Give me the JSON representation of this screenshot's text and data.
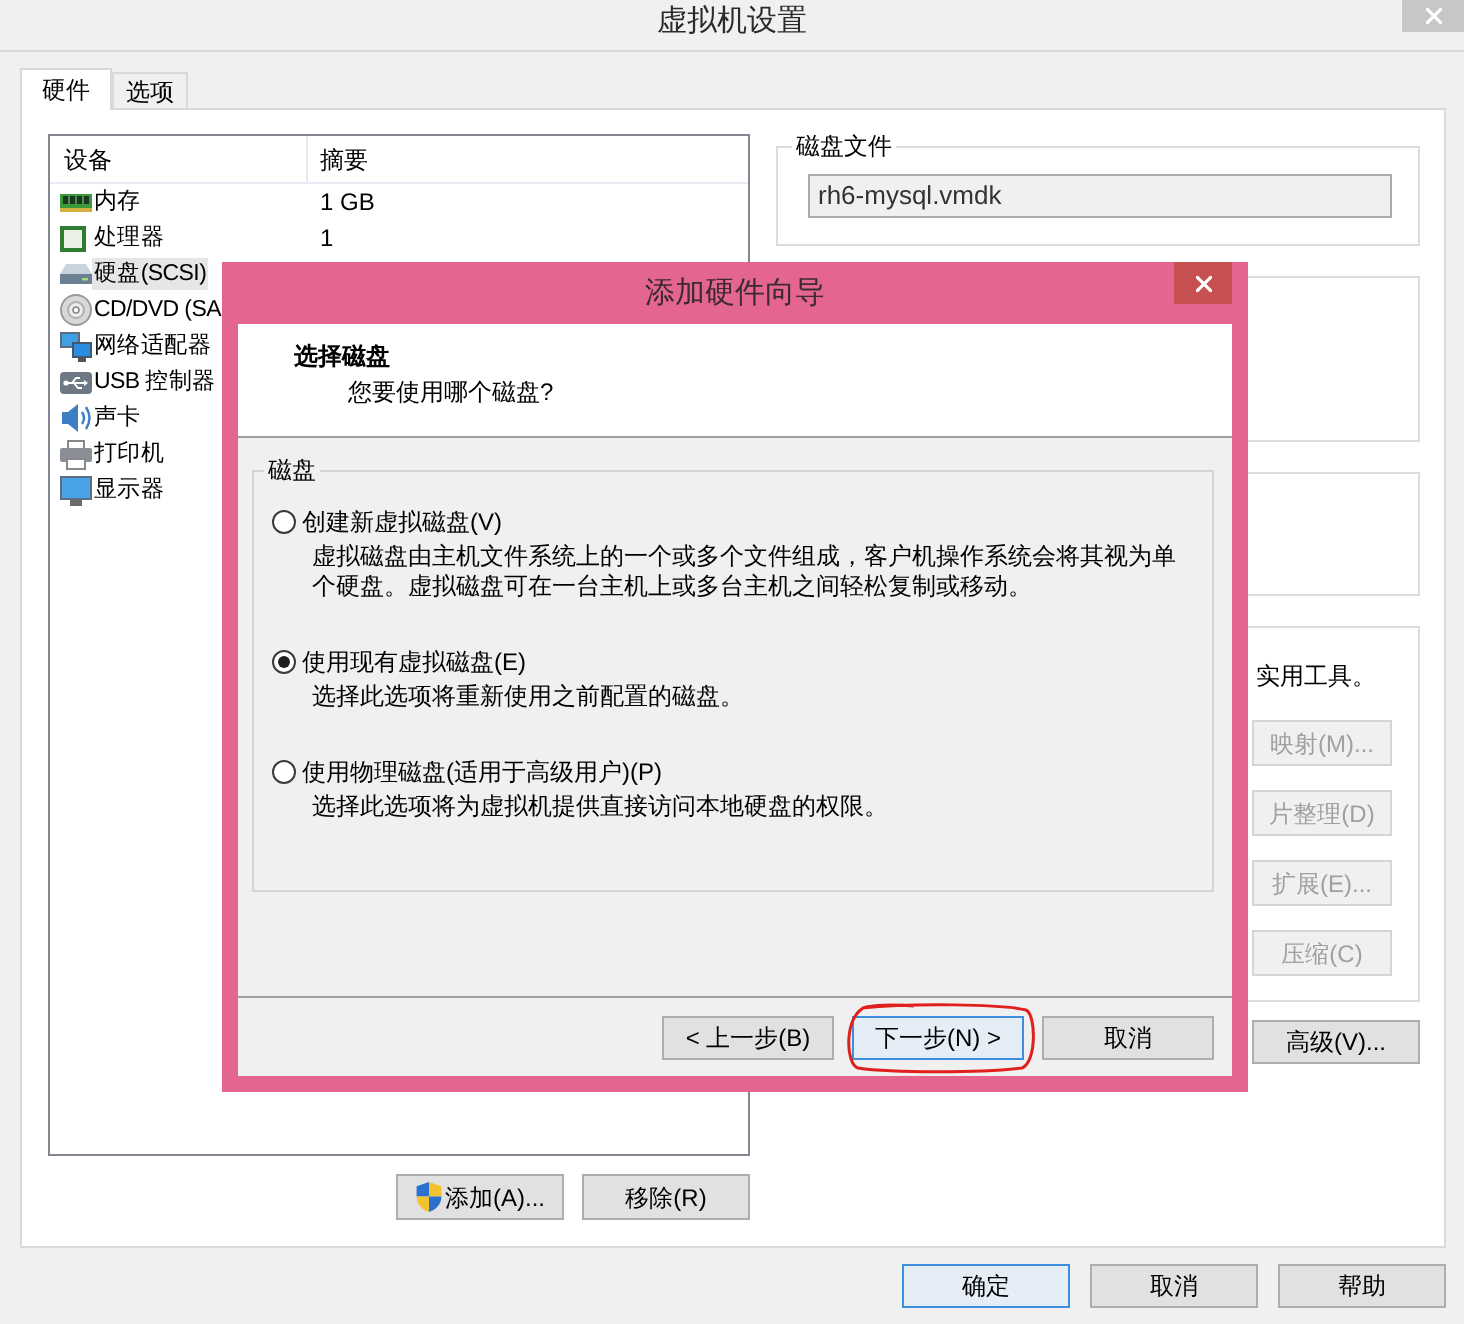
{
  "window": {
    "title": "虚拟机设置"
  },
  "tabs": [
    {
      "label": "硬件",
      "selected": true
    },
    {
      "label": "选项",
      "selected": false
    }
  ],
  "device_list": {
    "columns": [
      "设备",
      "摘要"
    ],
    "rows": [
      {
        "kind": "memory",
        "device": "内存",
        "summary": "1 GB",
        "selected": false
      },
      {
        "kind": "processor",
        "device": "处理器",
        "summary": "1",
        "selected": false
      },
      {
        "kind": "hard_disk",
        "device": "硬盘(SCSI)",
        "selected": true
      },
      {
        "kind": "cd_dvd",
        "device": "CD/DVD (SA",
        "selected": false
      },
      {
        "kind": "network",
        "device": "网络适配器",
        "selected": false
      },
      {
        "kind": "usb",
        "device": "USB 控制器",
        "selected": false
      },
      {
        "kind": "sound",
        "device": "声卡",
        "selected": false
      },
      {
        "kind": "printer",
        "device": "打印机",
        "selected": false
      },
      {
        "kind": "display",
        "device": "显示器",
        "selected": false
      }
    ]
  },
  "list_buttons": [
    {
      "label": "添加(A)...",
      "kind": "shield"
    },
    {
      "label": "移除(R)",
      "kind": "plain"
    }
  ],
  "disk_file": {
    "label": "磁盘文件",
    "value": "rh6-mysql.vmdk"
  },
  "disk_utilities": {
    "text": "实用工具。",
    "buttons": [
      {
        "label": "映射(M)...",
        "disabled": true
      },
      {
        "label": "片整理(D)",
        "disabled": true
      },
      {
        "label": "扩展(E)...",
        "disabled": true
      },
      {
        "label": "压缩(C)",
        "disabled": true
      }
    ]
  },
  "advanced_button": {
    "label": "高级(V)...",
    "disabled": false
  },
  "footer_buttons": [
    {
      "label": "确定",
      "default": true
    },
    {
      "label": "取消",
      "default": false
    },
    {
      "label": "帮助",
      "default": false
    }
  ],
  "wizard": {
    "title": "添加硬件向导",
    "heading": "选择磁盘",
    "subheading": "您要使用哪个磁盘?",
    "group_label": "磁盘",
    "options": [
      {
        "label": "创建新虚拟磁盘(V)",
        "description": "虚拟磁盘由主机文件系统上的一个或多个文件组成，客户机操作系统会将其视为单个硬盘。虚拟磁盘可在一台主机上或多台主机之间轻松复制或移动。",
        "selected": false
      },
      {
        "label": "使用现有虚拟磁盘(E)",
        "description": "选择此选项将重新使用之前配置的磁盘。",
        "selected": true
      },
      {
        "label": "使用物理磁盘(适用于高级用户)(P)",
        "description": "选择此选项将为虚拟机提供直接访问本地硬盘的权限。",
        "selected": false
      }
    ],
    "buttons": [
      {
        "label": "< 上一步(B)",
        "default": false,
        "annotated": false
      },
      {
        "label": "下一步(N) >",
        "default": true,
        "annotated": true
      },
      {
        "label": "取消",
        "default": false,
        "annotated": false
      }
    ]
  }
}
